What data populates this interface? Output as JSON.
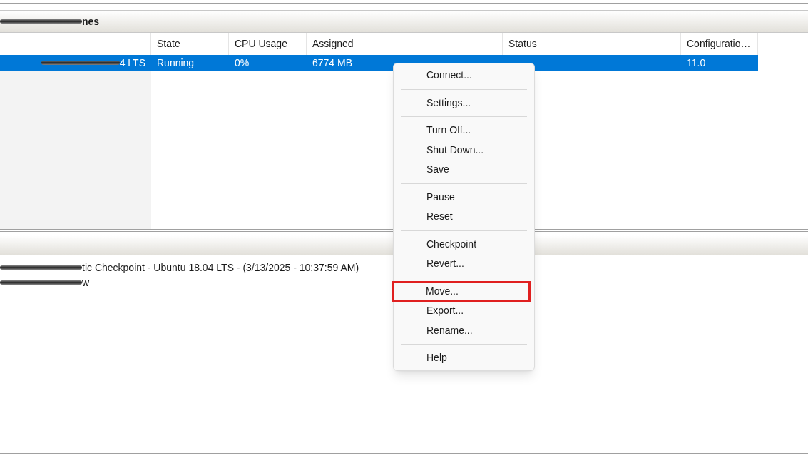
{
  "vm_pane": {
    "title": "nes",
    "columns": [
      {},
      {
        "label": "State"
      },
      {
        "label": "CPU Usage"
      },
      {
        "label": "Assigned"
      },
      {
        "label": "Status"
      },
      {
        "label": "Configuratio…"
      }
    ],
    "rows": [
      {
        "selected": true,
        "cells": [
          "4 LTS",
          "Running",
          "0%",
          "6774 MB",
          "",
          "11.0"
        ]
      }
    ]
  },
  "checkpoint_pane": {
    "items": [
      {
        "text": "tic Checkpoint - Ubuntu 18.04 LTS - (3/13/2025 - 10:37:59 AM)"
      },
      {
        "text": "w"
      }
    ]
  },
  "context_menu": {
    "items": [
      {
        "kind": "item",
        "label": "Connect...",
        "highlighted": false
      },
      {
        "kind": "separator"
      },
      {
        "kind": "item",
        "label": "Settings...",
        "highlighted": false
      },
      {
        "kind": "separator"
      },
      {
        "kind": "item",
        "label": "Turn Off...",
        "highlighted": false
      },
      {
        "kind": "item",
        "label": "Shut Down...",
        "highlighted": false
      },
      {
        "kind": "item",
        "label": "Save",
        "highlighted": false
      },
      {
        "kind": "separator"
      },
      {
        "kind": "item",
        "label": "Pause",
        "highlighted": false
      },
      {
        "kind": "item",
        "label": "Reset",
        "highlighted": false
      },
      {
        "kind": "separator"
      },
      {
        "kind": "item",
        "label": "Checkpoint",
        "highlighted": false
      },
      {
        "kind": "item",
        "label": "Revert...",
        "highlighted": false
      },
      {
        "kind": "separator"
      },
      {
        "kind": "item",
        "label": "Move...",
        "highlighted": true
      },
      {
        "kind": "item",
        "label": "Export...",
        "highlighted": false
      },
      {
        "kind": "item",
        "label": "Rename...",
        "highlighted": false
      },
      {
        "kind": "separator"
      },
      {
        "kind": "item",
        "label": "Help",
        "highlighted": false
      }
    ]
  }
}
